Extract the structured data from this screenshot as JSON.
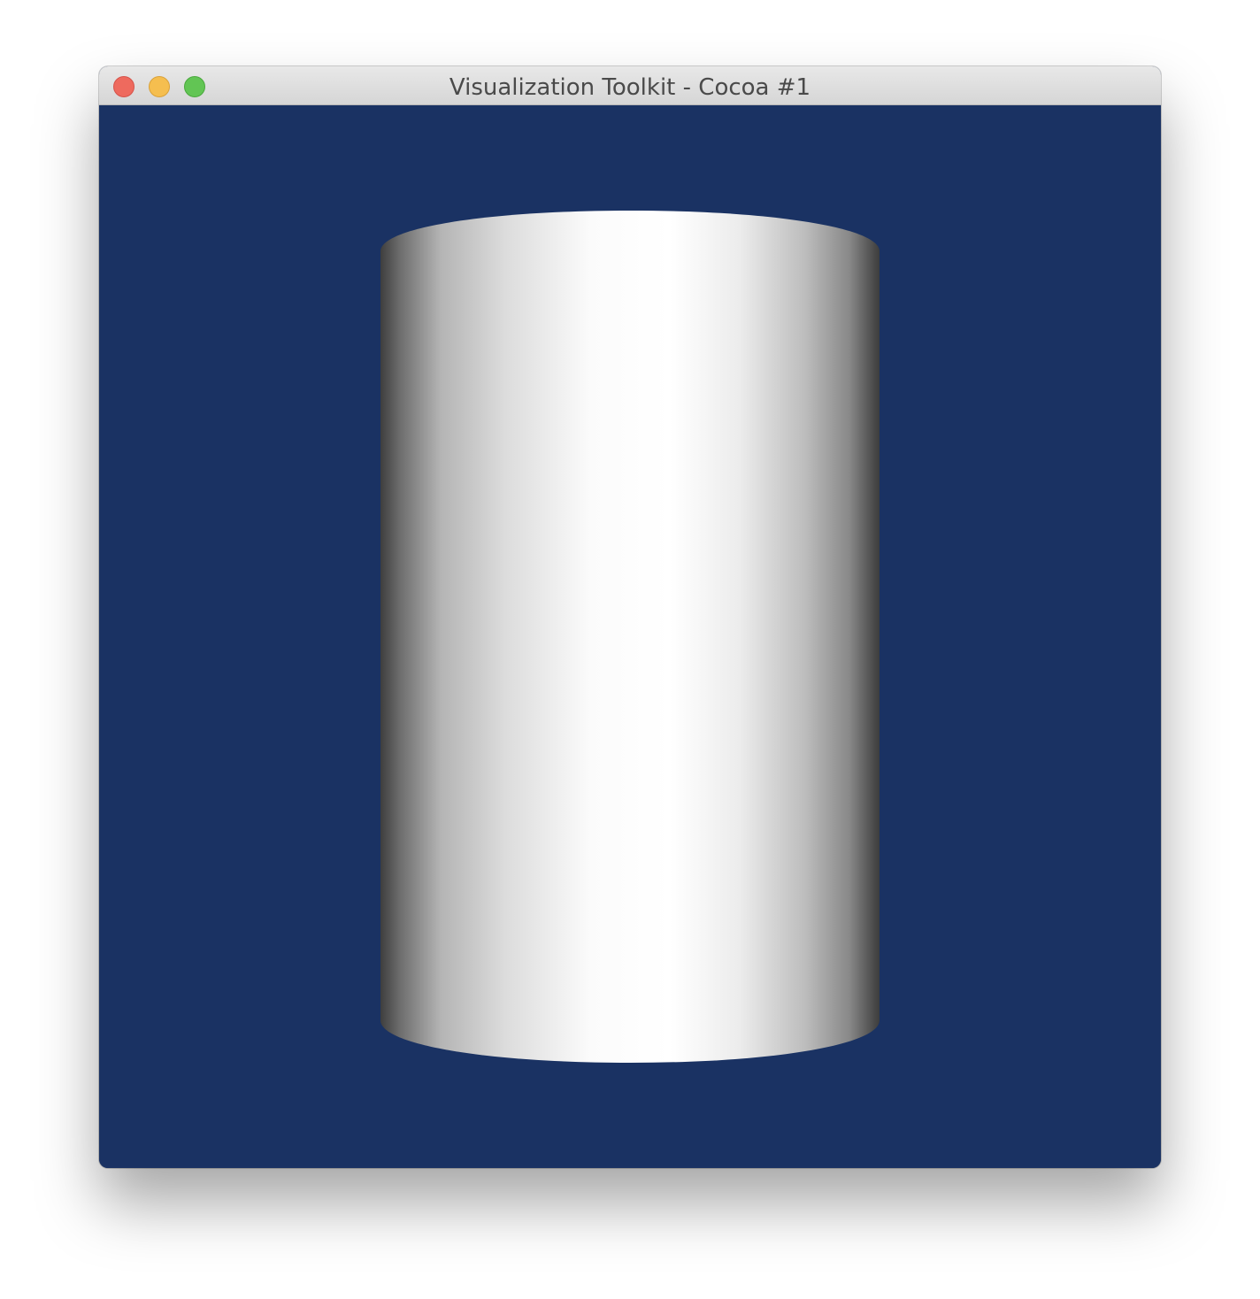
{
  "window": {
    "title": "Visualization Toolkit - Cocoa #1",
    "background_color": "#1a3263"
  },
  "traffic_lights": [
    {
      "name": "close",
      "color": "#ee6a5e"
    },
    {
      "name": "minimize",
      "color": "#f5be4f"
    },
    {
      "name": "zoom",
      "color": "#62c554"
    }
  ],
  "scene": {
    "object": "cylinder",
    "shading": "grayscale-gradient"
  }
}
